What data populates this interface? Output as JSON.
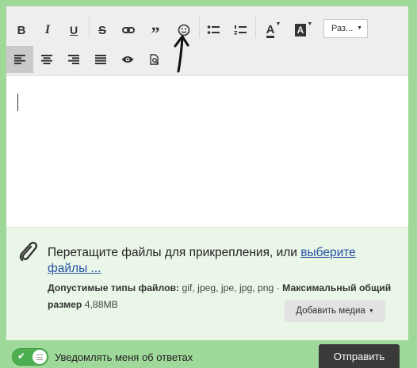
{
  "toolbar": {
    "row1": [
      {
        "name": "bold-icon",
        "glyph": "B"
      },
      {
        "name": "italic-icon",
        "glyph": "I"
      },
      {
        "name": "underline-icon",
        "glyph": "U"
      },
      {
        "name": "strikethrough-icon",
        "glyph": "S"
      },
      {
        "name": "link-icon"
      },
      {
        "name": "quote-icon",
        "glyph": "”"
      },
      {
        "name": "emoji-icon"
      },
      {
        "name": "bullet-list-icon"
      },
      {
        "name": "numbered-list-icon"
      },
      {
        "name": "text-color-icon",
        "glyph": "A"
      },
      {
        "name": "background-color-icon",
        "glyph": "A"
      }
    ],
    "size_dropdown_label": "Раз...",
    "row2": [
      {
        "name": "align-left-icon",
        "active": true
      },
      {
        "name": "align-center-icon"
      },
      {
        "name": "align-right-icon"
      },
      {
        "name": "align-justify-icon"
      },
      {
        "name": "eye-icon"
      },
      {
        "name": "document-search-icon"
      }
    ]
  },
  "attachments": {
    "drop_text": "Перетащите файлы для прикрепления, или ",
    "select_link": "выберите файлы ...",
    "allowed_label": "Допустимые типы файлов:",
    "allowed_value": " gif, jpeg, jpe, jpg, png · ",
    "max_label": "Максимальный общий размер",
    "max_value": " 4,88MB",
    "add_media_label": "Добавить медиа"
  },
  "footer": {
    "notify_label": "Уведомлять меня об ответах",
    "notify_on": true,
    "send_label": "Отправить"
  },
  "colors": {
    "background": "#9fd99a",
    "link": "#2553a6",
    "toggle_on": "#4caf50",
    "send_button": "#3a3a3a"
  }
}
